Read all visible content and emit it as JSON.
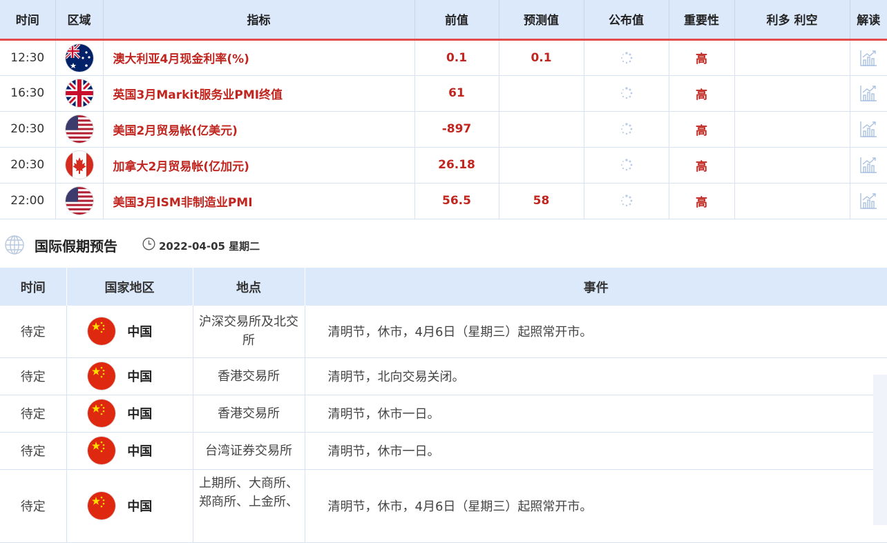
{
  "econ_table": {
    "headers": [
      "时间",
      "区域",
      "指标",
      "前值",
      "预测值",
      "公布值",
      "重要性",
      "利多 利空",
      "解读"
    ],
    "rows": [
      {
        "time": "12:30",
        "flag": "australia-flag-icon",
        "indicator": "澳大利亚4月现金利率(%)",
        "prev": "0.1",
        "forecast": "0.1",
        "actual": "",
        "importance": "高"
      },
      {
        "time": "16:30",
        "flag": "uk-flag-icon",
        "indicator": "英国3月Markit服务业PMI终值",
        "prev": "61",
        "forecast": "",
        "actual": "",
        "importance": "高"
      },
      {
        "time": "20:30",
        "flag": "us-flag-icon",
        "indicator": "美国2月贸易帐(亿美元)",
        "prev": "-897",
        "forecast": "",
        "actual": "",
        "importance": "高"
      },
      {
        "time": "20:30",
        "flag": "canada-flag-icon",
        "indicator": "加拿大2月贸易帐(亿加元)",
        "prev": "26.18",
        "forecast": "",
        "actual": "",
        "importance": "高"
      },
      {
        "time": "22:00",
        "flag": "us-flag-icon",
        "indicator": "美国3月ISM非制造业PMI",
        "prev": "56.5",
        "forecast": "58",
        "actual": "",
        "importance": "高"
      }
    ]
  },
  "holiday_section": {
    "title": "国际假期预告",
    "date": "2022-04-05 星期二",
    "headers": [
      "时间",
      "国家地区",
      "地点",
      "事件"
    ],
    "rows": [
      {
        "time": "待定",
        "flag": "china-flag-icon",
        "country": "中国",
        "place": "沪深交易所及北交所",
        "event": "清明节，休市，4月6日（星期三）起照常开市。"
      },
      {
        "time": "待定",
        "flag": "china-flag-icon",
        "country": "中国",
        "place": "香港交易所",
        "event": "清明节，北向交易关闭。"
      },
      {
        "time": "待定",
        "flag": "china-flag-icon",
        "country": "中国",
        "place": "香港交易所",
        "event": "清明节，休市一日。"
      },
      {
        "time": "待定",
        "flag": "china-flag-icon",
        "country": "中国",
        "place": "台湾证券交易所",
        "event": "清明节，休市一日。"
      },
      {
        "time": "待定",
        "flag": "china-flag-icon",
        "country": "中国",
        "place": "上期所、大商所、郑商所、上金所、",
        "event": "清明节，休市，4月6日（星期三）起照常开市。"
      }
    ]
  },
  "colors": {
    "header_bg": "#dce9fb",
    "accent_red": "#c0261f",
    "divider_red": "#e34a4a"
  }
}
